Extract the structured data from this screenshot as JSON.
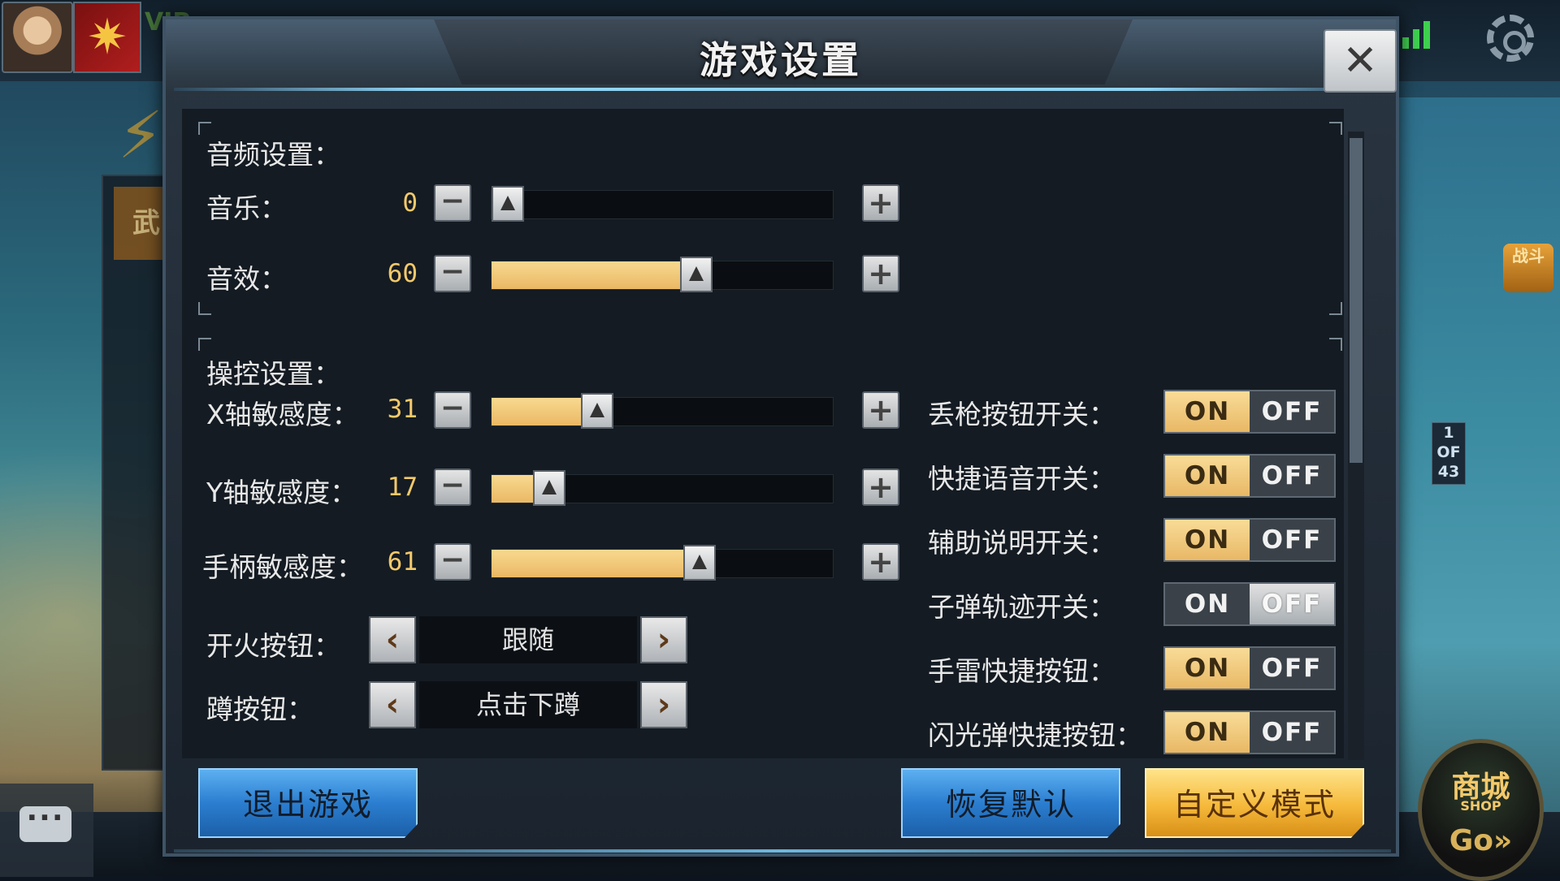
{
  "hud": {
    "vip_text": "VIP",
    "battle_badge": "战斗",
    "page_indicator": {
      "current": "1",
      "of": "OF",
      "total": "43"
    },
    "chat_icon": "···",
    "shop": {
      "main": "商城",
      "sub": "SHOP",
      "go": "Go»"
    }
  },
  "dialog": {
    "title": "游戏设置",
    "close_icon": "✕",
    "audio": {
      "title": "音频设置：",
      "rows": [
        {
          "label": "音乐：",
          "value": "0",
          "level": 0
        },
        {
          "label": "音效：",
          "value": "60",
          "level": 60
        }
      ]
    },
    "controls": {
      "title": "操控设置：",
      "sliders": [
        {
          "label": "X轴敏感度：",
          "value": "31",
          "level": 31
        },
        {
          "label": "Y轴敏感度：",
          "value": "17",
          "level": 17
        },
        {
          "label": "手柄敏感度：",
          "value": "61",
          "level": 61
        }
      ],
      "selects": [
        {
          "label": "开火按钮：",
          "value": "跟随"
        },
        {
          "label": "蹲按钮：",
          "value": "点击下蹲"
        }
      ],
      "toggles": [
        {
          "label": "丢枪按钮开关：",
          "on": "ON",
          "off": "OFF",
          "state": "on"
        },
        {
          "label": "快捷语音开关：",
          "on": "ON",
          "off": "OFF",
          "state": "on"
        },
        {
          "label": "辅助说明开关：",
          "on": "ON",
          "off": "OFF",
          "state": "on"
        },
        {
          "label": "子弹轨迹开关：",
          "on": "ON",
          "off": "OFF",
          "state": "off"
        },
        {
          "label": "手雷快捷按钮：",
          "on": "ON",
          "off": "OFF",
          "state": "on"
        },
        {
          "label": "闪光弹快捷按钮：",
          "on": "ON",
          "off": "OFF",
          "state": "on"
        }
      ]
    },
    "buttons": {
      "exit": "退出游戏",
      "restore": "恢复默认",
      "custom": "自定义模式"
    },
    "step": {
      "minus": "−",
      "plus": "+"
    },
    "arrows": {
      "left": "‹",
      "right": "›"
    }
  },
  "colors": {
    "accent_gold": "#f3c96b",
    "slider_fill": "#eab864",
    "button_blue": "#2b7ed0",
    "button_gold": "#f5b93a"
  }
}
